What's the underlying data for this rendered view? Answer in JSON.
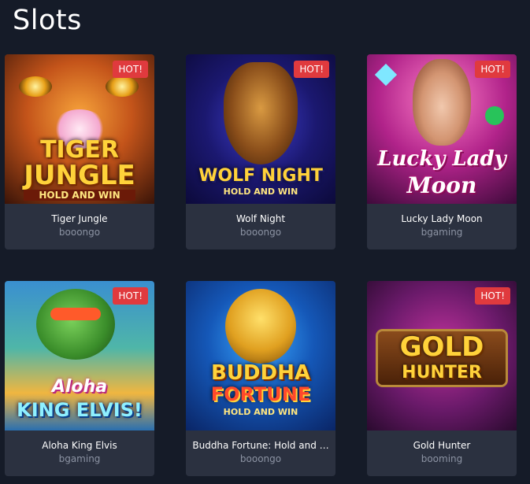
{
  "page": {
    "title": "Slots"
  },
  "games": [
    {
      "name": "Tiger Jungle",
      "provider": "booongo",
      "badge": "HOT!",
      "art_line1": "TIGER",
      "art_line2": "JUNGLE",
      "art_line3": "HOLD AND WIN"
    },
    {
      "name": "Wolf Night",
      "provider": "booongo",
      "badge": "HOT!",
      "art_line1": "WOLF NIGHT",
      "art_line2": "HOLD AND WIN"
    },
    {
      "name": "Lucky Lady Moon",
      "provider": "bgaming",
      "badge": "HOT!",
      "art_line1": "Lucky Lady",
      "art_line2": "Moon"
    },
    {
      "name": "Aloha King Elvis",
      "provider": "bgaming",
      "badge": "HOT!",
      "art_line1": "Aloha",
      "art_line2": "KING ELVIS!"
    },
    {
      "name": "Buddha Fortune: Hold and …",
      "provider": "booongo",
      "art_line1": "BUDDHA",
      "art_line2": "FORTUNE",
      "art_line3": "HOLD AND WIN"
    },
    {
      "name": "Gold Hunter",
      "provider": "booming",
      "badge": "HOT!",
      "art_line1": "GOLD",
      "art_line2": "HUNTER"
    }
  ]
}
